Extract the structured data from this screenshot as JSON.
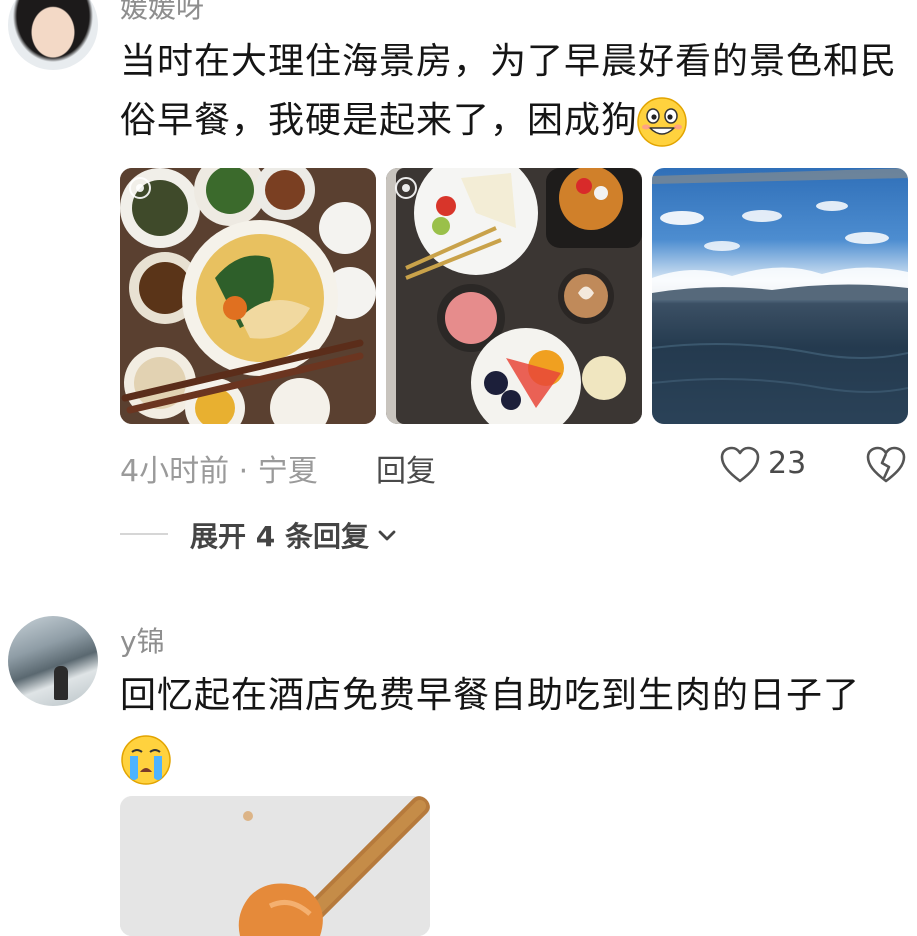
{
  "comments": [
    {
      "username": "媛媛呀",
      "text_line1": "当时在大理住海景房，为了早晨好看的景色和民",
      "text_line2": "俗早餐，我硬是起来了，困成狗",
      "emoji": "grinning-emoji",
      "time_location": "4小时前 · 宁夏",
      "reply_label": "回复",
      "like_count": "23",
      "expand_label": "展开 4 条回复"
    },
    {
      "username": "y锦",
      "text_line1": "回忆起在酒店免费早餐自助吃到生肉的日子了",
      "emoji": "crying-emoji"
    }
  ],
  "colors": {
    "text": "#151515",
    "meta": "#9a9a9a",
    "emoji_yellow": "#ffd23e"
  }
}
